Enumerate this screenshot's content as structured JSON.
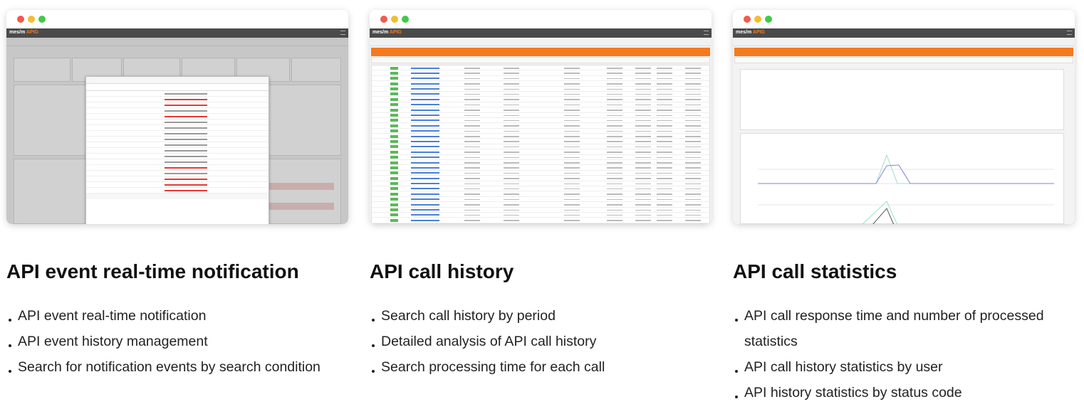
{
  "app": {
    "logo_left": "mes/m",
    "logo_right": "APIG"
  },
  "cards": [
    {
      "window_label": "API event real-time notification screenshot",
      "title": "API event real-time notification",
      "bullets": [
        "API event real-time notification",
        "API event history management",
        "Search for notification events by search condition"
      ]
    },
    {
      "window_label": "API call history screenshot",
      "title": "API call history",
      "bullets": [
        "Search call history by period",
        "Detailed analysis of API call history",
        "Search processing time for each call"
      ]
    },
    {
      "window_label": "API call statistics screenshot",
      "title": "API call statistics",
      "bullets": [
        "API call response time and number of processed",
        "statistics",
        "API call history statistics by user",
        "API history statistics by status code"
      ]
    }
  ],
  "colors": {
    "accent": "#f47a20",
    "appbar": "#4a4a4a",
    "link": "#4a7fd6",
    "success": "#5cb85c",
    "alert": "#e53935"
  },
  "icons": [
    "window-close-dot",
    "window-minimize-dot",
    "window-maximize-dot",
    "menu-icon"
  ]
}
